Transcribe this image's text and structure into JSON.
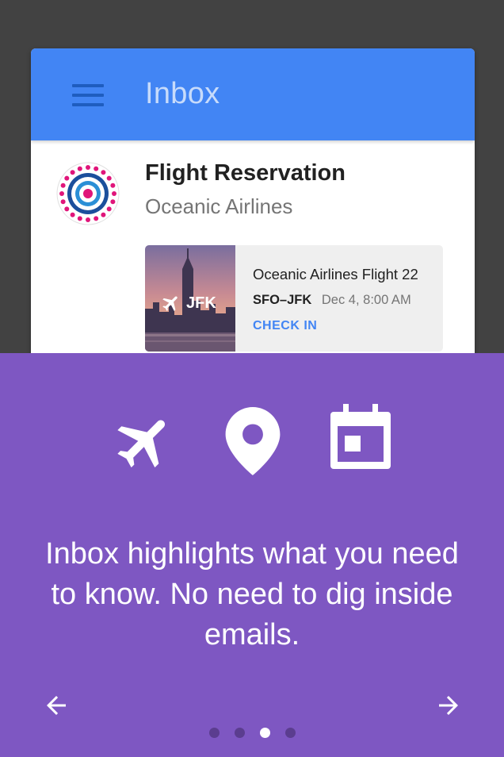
{
  "app_bar": {
    "title": "Inbox"
  },
  "email": {
    "subject": "Flight Reservation",
    "sender": "Oceanic Airlines",
    "flight_card": {
      "destination_code": "JFK",
      "title": "Oceanic Airlines Flight 22",
      "route": "SFO–JFK",
      "datetime": "Dec 4, 8:00 AM",
      "action": "CHECK IN"
    }
  },
  "onboarding": {
    "icons": [
      "airplane-icon",
      "location-pin-icon",
      "calendar-icon"
    ],
    "message": "Inbox highlights what you need to know. No need to dig inside emails.",
    "pagination": {
      "total": 4,
      "current": 3
    }
  },
  "colors": {
    "app_bar": "#4285f4",
    "panel": "#7e57c2",
    "accent_link": "#4285f4",
    "backdrop": "#424242"
  }
}
